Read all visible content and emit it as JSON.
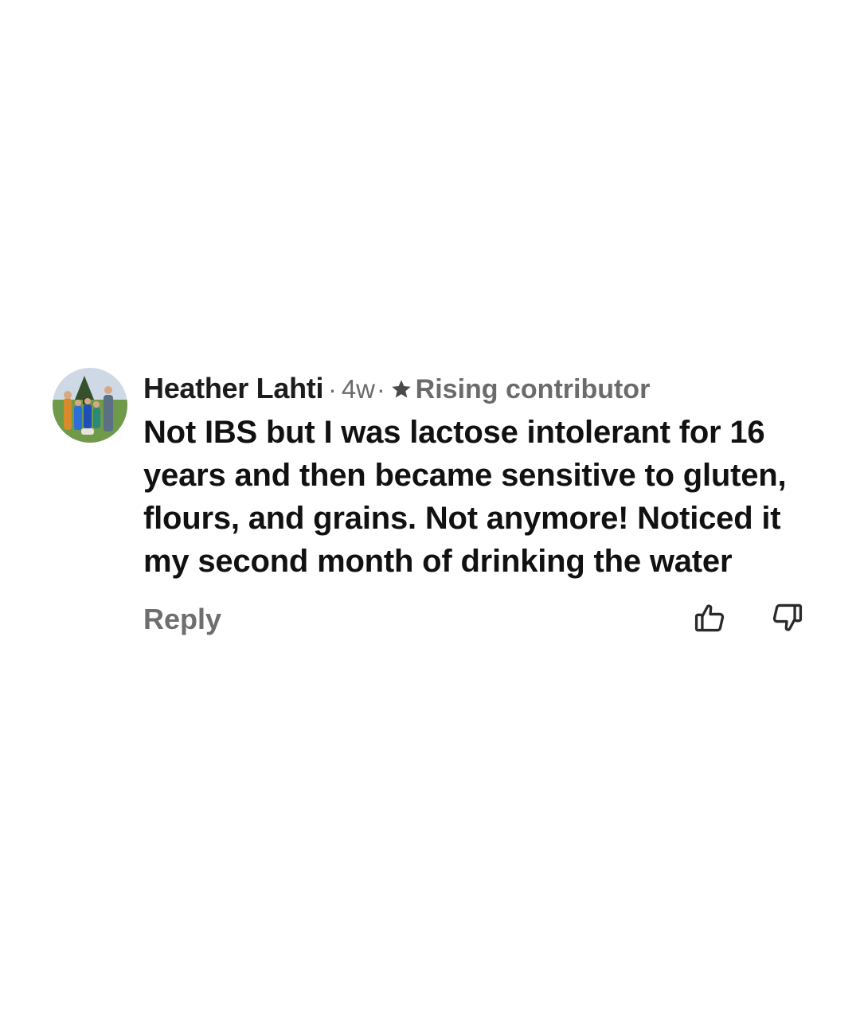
{
  "comment": {
    "author": "Heather Lahti",
    "separator": "·",
    "time": "4w",
    "time_separator": "·",
    "badge": {
      "icon": "star-icon",
      "label": "Rising contributor"
    },
    "text": "Not IBS but I was lactose intolerant for 16 years and then became sensitive to gluten, flours, and grains. Not anymore! Noticed it my second month of drinking the water",
    "actions": {
      "reply_label": "Reply",
      "upvote_icon": "thumbs-up-icon",
      "downvote_icon": "thumbs-down-icon"
    }
  },
  "colors": {
    "text_primary": "#111111",
    "text_secondary": "#6b6b6b",
    "background": "#ffffff"
  }
}
